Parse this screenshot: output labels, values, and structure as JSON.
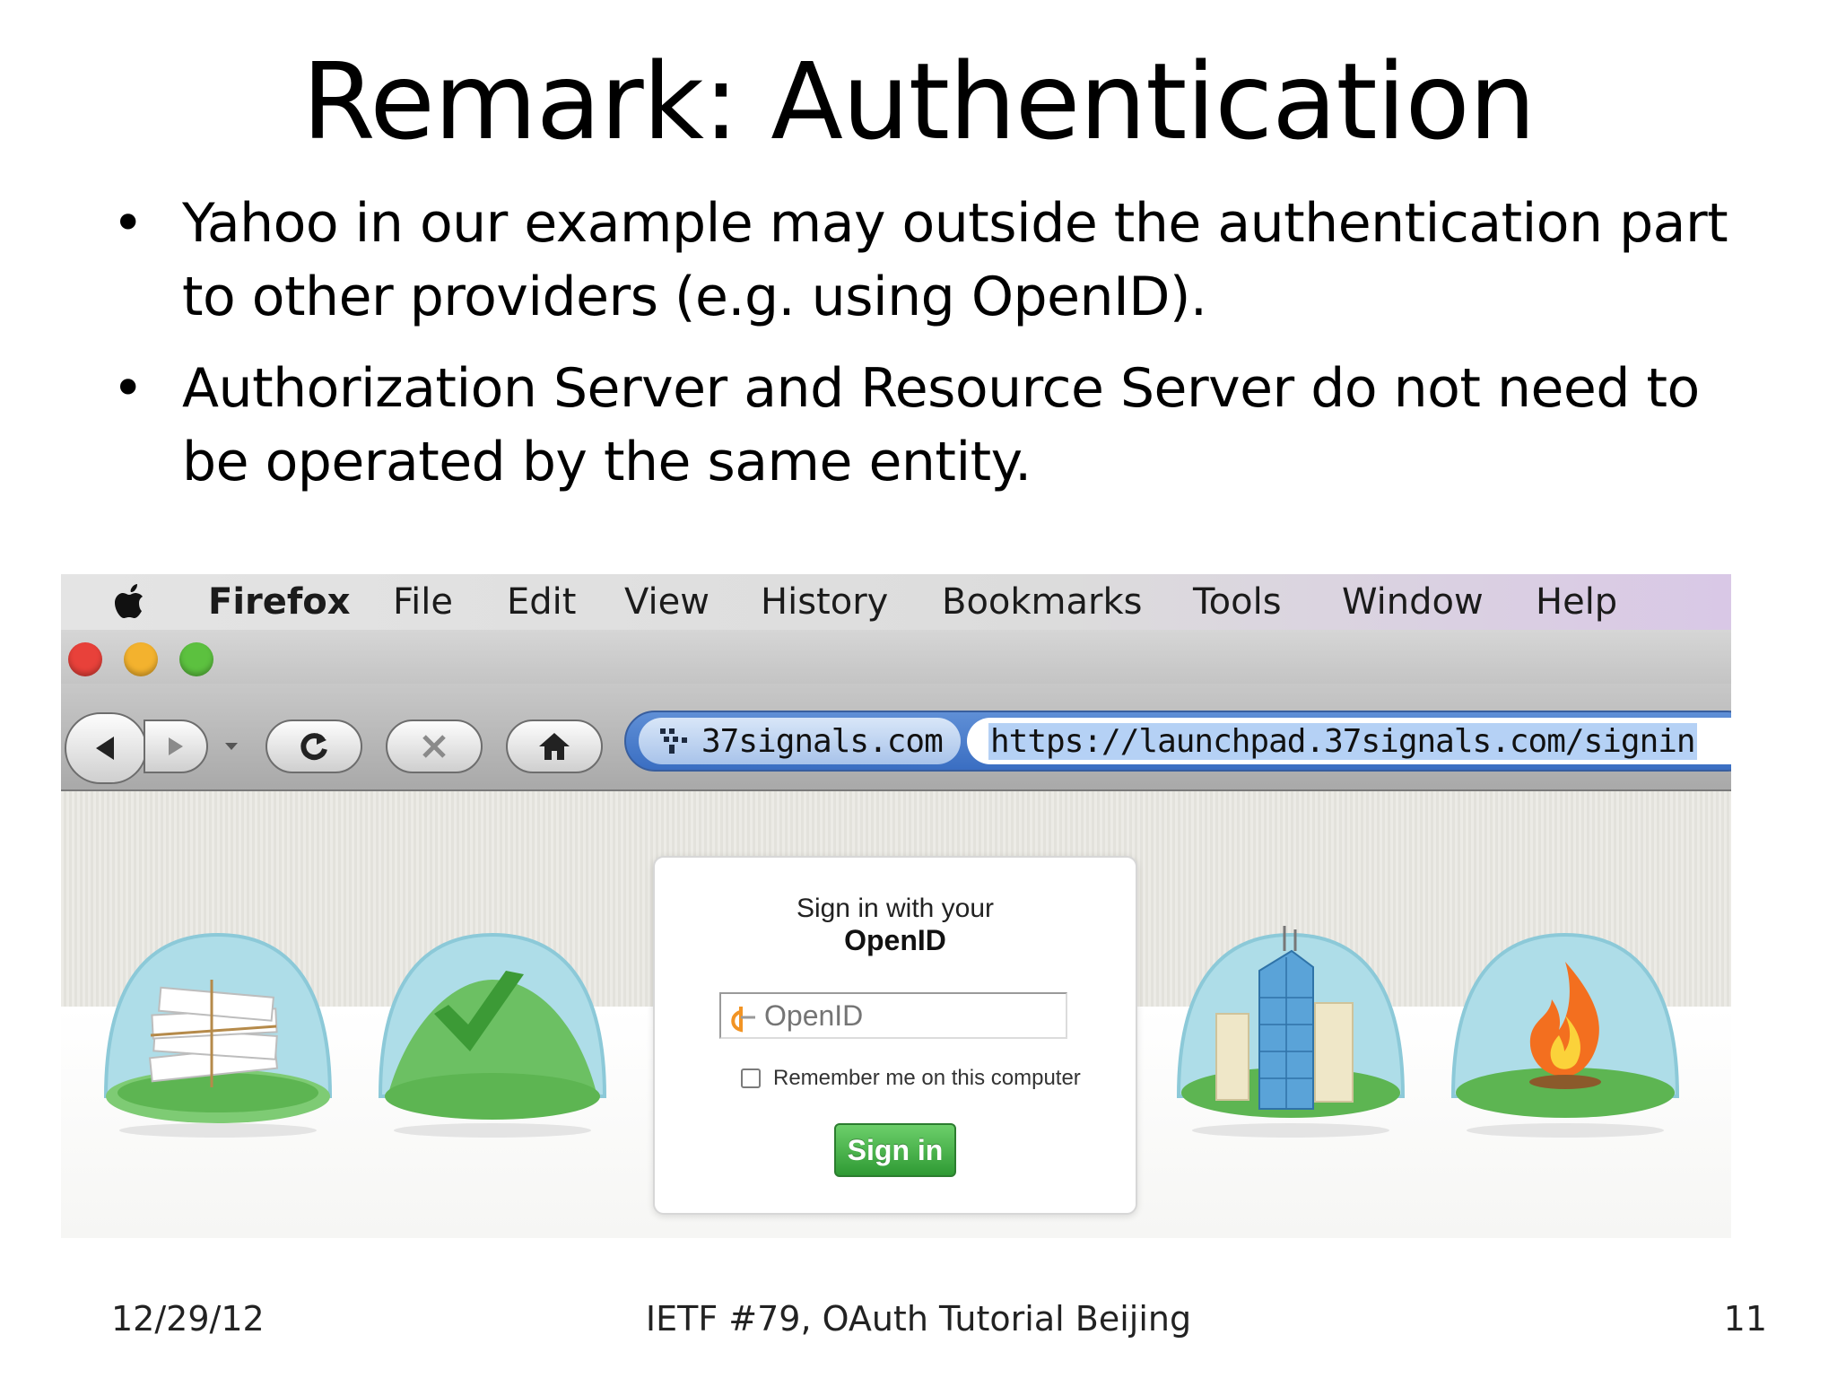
{
  "slide": {
    "title": "Remark: Authentication",
    "bullets": [
      "Yahoo in our example may outside the authentication part to other providers (e.g. using OpenID).",
      "Authorization Server and Resource Server do not need to be operated by the same entity."
    ],
    "footer": {
      "date": "12/29/12",
      "center": "IETF #79, OAuth Tutorial Beijing",
      "page_number": "11"
    }
  },
  "browser": {
    "menu": [
      "Firefox",
      "File",
      "Edit",
      "View",
      "History",
      "Bookmarks",
      "Tools",
      "Window",
      "Help"
    ],
    "site_identity": "37signals.com",
    "url": "https://launchpad.37signals.com/signin",
    "traffic_light_colors": [
      "#e8413a",
      "#f3b22e",
      "#5cc13f"
    ]
  },
  "signin_card": {
    "line1": "Sign in with your",
    "line2": "OpenID",
    "input_placeholder": "OpenID",
    "remember_label": "Remember me on this computer",
    "button_label": "Sign in",
    "button_color": "#3fae40"
  },
  "icons": [
    "apple-icon",
    "back-icon",
    "forward-icon",
    "reload-icon",
    "stop-icon",
    "home-icon",
    "site-identity-icon",
    "openid-logo-icon",
    "documents-dome-icon",
    "checkmark-dome-icon",
    "buildings-dome-icon",
    "flame-dome-icon"
  ]
}
